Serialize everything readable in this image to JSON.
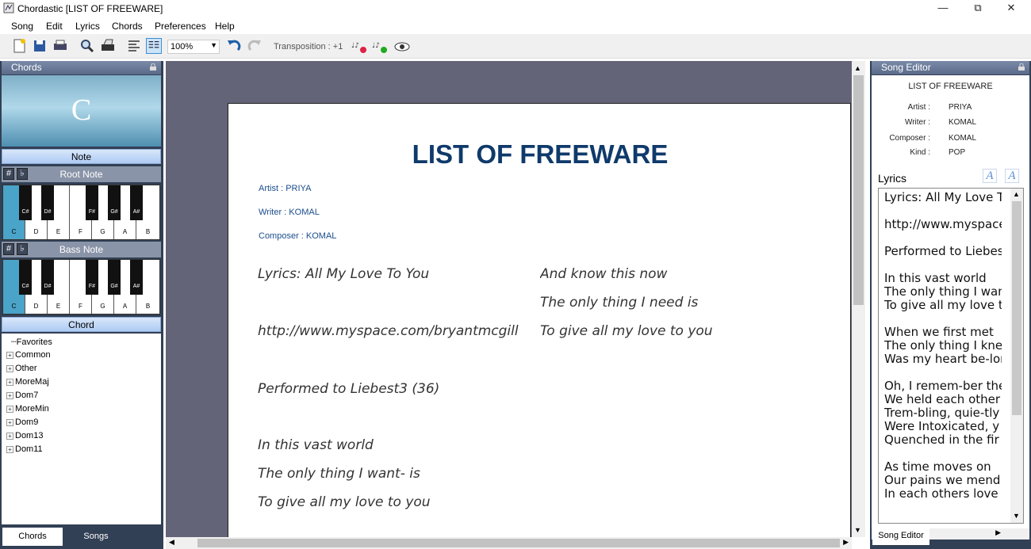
{
  "window": {
    "title": "Chordastic [LIST OF FREEWARE]",
    "controls": {
      "minimize": "—",
      "maximize": "⧉",
      "close": "✕"
    }
  },
  "menu": [
    "Song",
    "Edit",
    "Lyrics",
    "Chords",
    "Preferences",
    "Help"
  ],
  "toolbar": {
    "zoom": "100%",
    "transposition": "Transposition : +1",
    "icons": [
      "new-document-icon",
      "save-icon",
      "print-icon",
      "search-icon",
      "print-setup-icon",
      "align-left-icon",
      "columns-icon",
      "undo-icon",
      "redo-icon",
      "transpose-down-icon",
      "transpose-up-icon",
      "preview-icon"
    ]
  },
  "chords_panel": {
    "title": "Chords",
    "current_chord": "C",
    "note_header": "Note",
    "root_note_label": "Root Note",
    "bass_note_label": "Bass Note",
    "chord_header": "Chord",
    "sharp": "#",
    "flat": "♭",
    "white_keys": [
      "C",
      "D",
      "E",
      "F",
      "G",
      "A",
      "B"
    ],
    "black_keys": [
      "C#",
      "D#",
      "F#",
      "G#",
      "A#"
    ],
    "selected_key": "C",
    "tree": {
      "favorites": "Favorites",
      "items": [
        "Common",
        "Other",
        "MoreMaj",
        "Dom7",
        "MoreMin",
        "Dom9",
        "Dom13",
        "Dom11"
      ]
    },
    "tabs": [
      "Chords",
      "Songs"
    ]
  },
  "document": {
    "title": "LIST OF FREEWARE",
    "artist": "Artist : PRIYA",
    "writer": "Writer : KOMAL",
    "composer": "Composer : KOMAL",
    "col1": [
      "Lyrics: All My Love To You",
      "http://www.myspace.com/bryantmcgill",
      "Performed to Liebest3 (36)",
      "In this vast world",
      "The only thing I want- is",
      "To give all my love to you"
    ],
    "col2": [
      "And know this now",
      "The only thing I need is",
      "To give all my love to you"
    ]
  },
  "song_editor": {
    "title": "Song Editor",
    "song_title": "LIST OF FREEWARE",
    "fields": [
      {
        "key": "Artist :",
        "value": "PRIYA"
      },
      {
        "key": "Writer :",
        "value": "KOMAL"
      },
      {
        "key": "Composer :",
        "value": "KOMAL"
      },
      {
        "key": "Kind :",
        "value": "POP"
      }
    ],
    "lyrics_label": "Lyrics",
    "lyrics_text": "Lyrics: All My Love To You\n\nhttp://www.myspace.com/bryantmcgill\n\nPerformed to Liebest3 (36)\n\nIn this vast world\nThe only thing I want- is\nTo give all my love to you\n\nWhen we first met\nThe only thing I knew\nWas my heart be-longed to you\n\nOh, I remem-ber the\nWe held each other\nTrem-bling, quie-tly\nWere Intoxicated, y\nQuenched in the fir\n\nAs time moves on\nOur pains we mend\nIn each others love",
    "tab": "Song Editor"
  }
}
